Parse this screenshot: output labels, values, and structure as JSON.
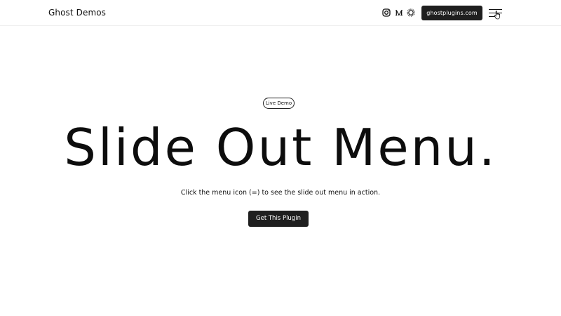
{
  "header": {
    "site_title": "Ghost Demos",
    "social_icons": [
      "instagram-icon",
      "medium-icon",
      "sun-icon"
    ],
    "site_button_label": "ghostplugins.com",
    "menu_icon": "hamburger-menu-icon"
  },
  "hero": {
    "badge_label": "Live Demo",
    "title": "Slide Out Menu.",
    "subtitle": "Click the menu icon (=) to see the slide out menu in action.",
    "cta_label": "Get This Plugin"
  },
  "colors": {
    "background": "#ffffff",
    "text": "#111111",
    "button_bg": "#1f1f1f",
    "button_text": "#ffffff"
  }
}
